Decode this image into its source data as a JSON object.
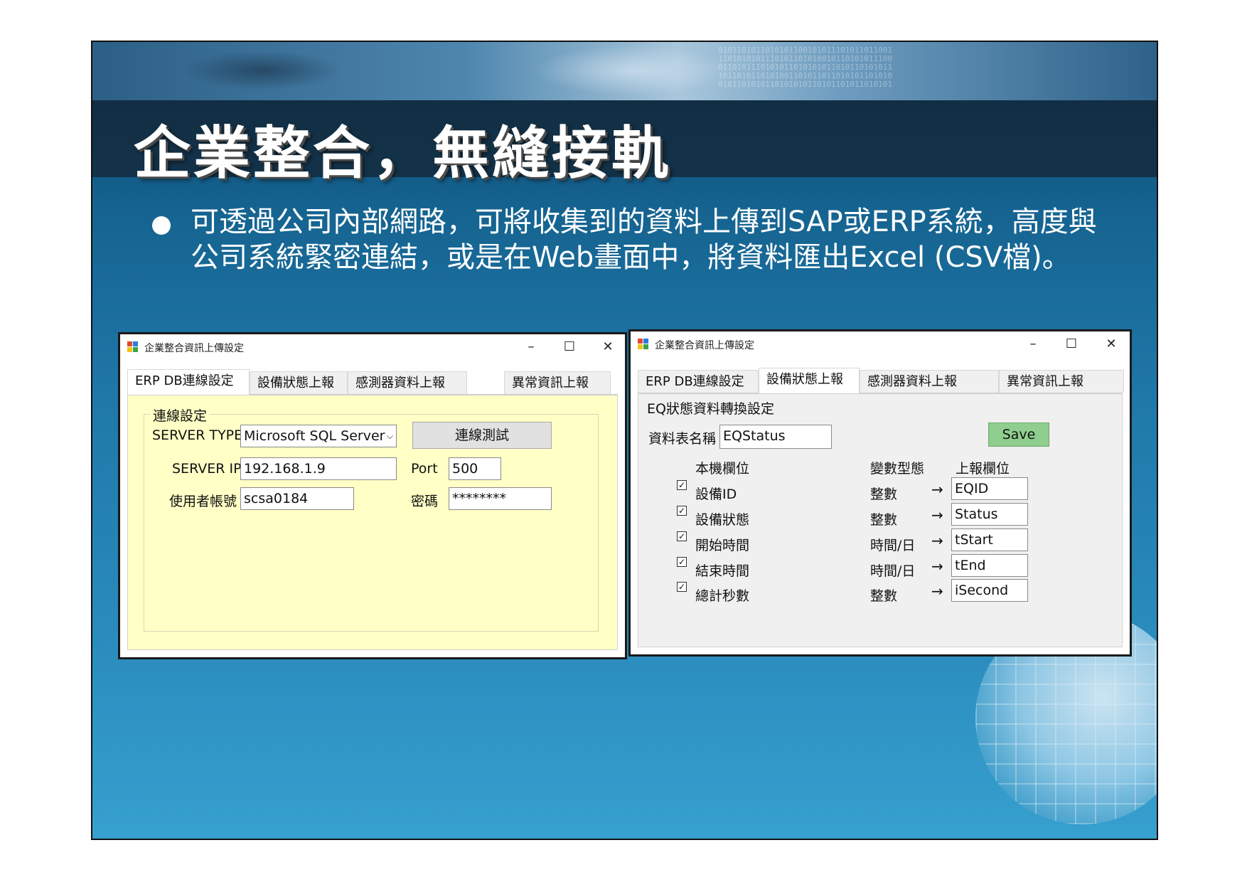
{
  "slide": {
    "title": "企業整合，無縫接軌",
    "bullet": "可透過公司內部網路，可將收集到的資料上傳到SAP或ERP系統，高度與公司系統緊密連結，或是在Web畫面中，將資料匯出Excel (CSV檔)。",
    "banner_bits": "0101101011010101100101011101011011001\n1101010101110101101010010110101011100\n0110101110101011010101011010110101011\n1011010110101001101011011010101101010\n0101101010110101010110101101011010101"
  },
  "window1": {
    "title": "企業整合資訊上傳設定",
    "controls": {
      "minimize": "–",
      "maximize": "☐",
      "close": "✕"
    },
    "tabs": [
      "ERP DB連線設定",
      "設備狀態上報",
      "感測器資料上報",
      "異常資訊上報"
    ],
    "active_tab": 0,
    "group_title": "連線設定",
    "server_type_label": "SERVER TYPE",
    "server_type_value": "Microsoft SQL Server",
    "test_button": "連線測試",
    "server_ip_label": "SERVER IP",
    "server_ip_value": "192.168.1.9",
    "port_label": "Port",
    "port_value": "500",
    "user_label": "使用者帳號",
    "user_value": "scsa0184",
    "password_label": "密碼",
    "password_value": "********",
    "panel_color": "#ffffc6"
  },
  "window2": {
    "title": "企業整合資訊上傳設定",
    "controls": {
      "minimize": "–",
      "maximize": "☐",
      "close": "✕"
    },
    "tabs": [
      "ERP DB連線設定",
      "設備狀態上報",
      "感測器資料上報",
      "異常資訊上報"
    ],
    "active_tab": 1,
    "section_title": "EQ狀態資料轉換設定",
    "table_name_label": "資料表名稱",
    "table_name_value": "EQStatus",
    "save_button": "Save",
    "save_color": "#8fce8f",
    "headers": {
      "local": "本機欄位",
      "type": "變數型態",
      "report": "上報欄位"
    },
    "rows": [
      {
        "checked": true,
        "local": "設備ID",
        "type": "整數",
        "report": "EQID"
      },
      {
        "checked": true,
        "local": "設備狀態",
        "type": "整數",
        "report": "Status"
      },
      {
        "checked": true,
        "local": "開始時間",
        "type": "時間/日",
        "report": "tStart"
      },
      {
        "checked": true,
        "local": "結束時間",
        "type": "時間/日",
        "report": "tEnd"
      },
      {
        "checked": true,
        "local": "總計秒數",
        "type": "整數",
        "report": "iSecond"
      }
    ],
    "arrow_glyph": "→",
    "check_glyph": "✓"
  }
}
